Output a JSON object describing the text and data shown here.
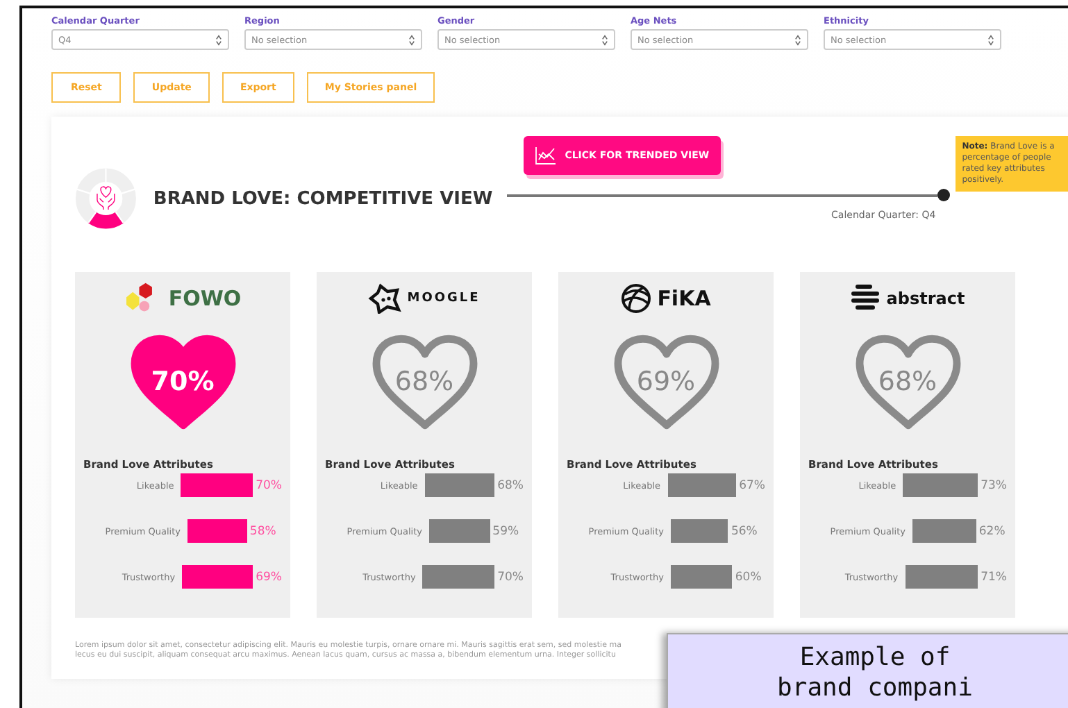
{
  "filters": [
    {
      "label": "Calendar Quarter",
      "value": "Q4"
    },
    {
      "label": "Region",
      "placeholder": "No selection"
    },
    {
      "label": "Gender",
      "placeholder": "No selection"
    },
    {
      "label": "Age Nets",
      "placeholder": "No selection"
    },
    {
      "label": "Ethnicity",
      "placeholder": "No selection"
    }
  ],
  "buttons": [
    "Reset",
    "Update",
    "Export",
    "My Stories panel"
  ],
  "header": {
    "title": "BRAND LOVE: COMPETITIVE VIEW",
    "trend_button": "CLICK FOR TRENDED VIEW",
    "note": "**Note:** Brand Love is a percentage of people rated key attributes positively.",
    "timeline": {
      "caption": "Calendar Quarter: Q4"
    }
  },
  "brands": [
    {
      "name": "FOWO",
      "kind": "hexagons",
      "highlighted": true,
      "score": "70%",
      "attributes_title": "Brand Love Attributes",
      "attributes": [
        {
          "label": "Likeable",
          "value": "70%"
        },
        {
          "label": "Premium Quality",
          "value": "58%"
        },
        {
          "label": "Trustworthy",
          "value": "69%"
        }
      ]
    },
    {
      "name": "MOOGLE",
      "kind": "blob",
      "highlighted": false,
      "score": "68%",
      "attributes_title": "Brand Love Attributes",
      "attributes": [
        {
          "label": "Likeable",
          "value": "68%"
        },
        {
          "label": "Premium Quality",
          "value": "59%"
        },
        {
          "label": "Trustworthy",
          "value": "70%"
        }
      ]
    },
    {
      "name": "FiKA",
      "kind": "globe",
      "highlighted": false,
      "score": "69%",
      "attributes_title": "Brand Love Attributes",
      "attributes": [
        {
          "label": "Likeable",
          "value": "67%"
        },
        {
          "label": "Premium Quality",
          "value": "56%"
        },
        {
          "label": "Trustworthy",
          "value": "60%"
        }
      ]
    },
    {
      "name": "abstract",
      "kind": "stripes",
      "highlighted": false,
      "score": "68%",
      "attributes_title": "Brand Love Attributes",
      "attributes": [
        {
          "label": "Likeable",
          "value": "73%"
        },
        {
          "label": "Premium Quality",
          "value": "62%"
        },
        {
          "label": "Trustworthy",
          "value": "71%"
        }
      ]
    }
  ],
  "footnote_lines": [
    "Lorem ipsum dolor sit amet, consectetur adipiscing elit. Mauris eu molestie turpis, ornare ornare mi. Mauris sagittis erat sem, sed molestie ma",
    "lecus eu dui suscipit, aliquam consequat arcu maximus. Aenean lacus quam, cursus ac massa a, bibendum elementum urna. Integer sollicitu"
  ],
  "caption": [
    "Example of",
    "brand compani"
  ]
}
